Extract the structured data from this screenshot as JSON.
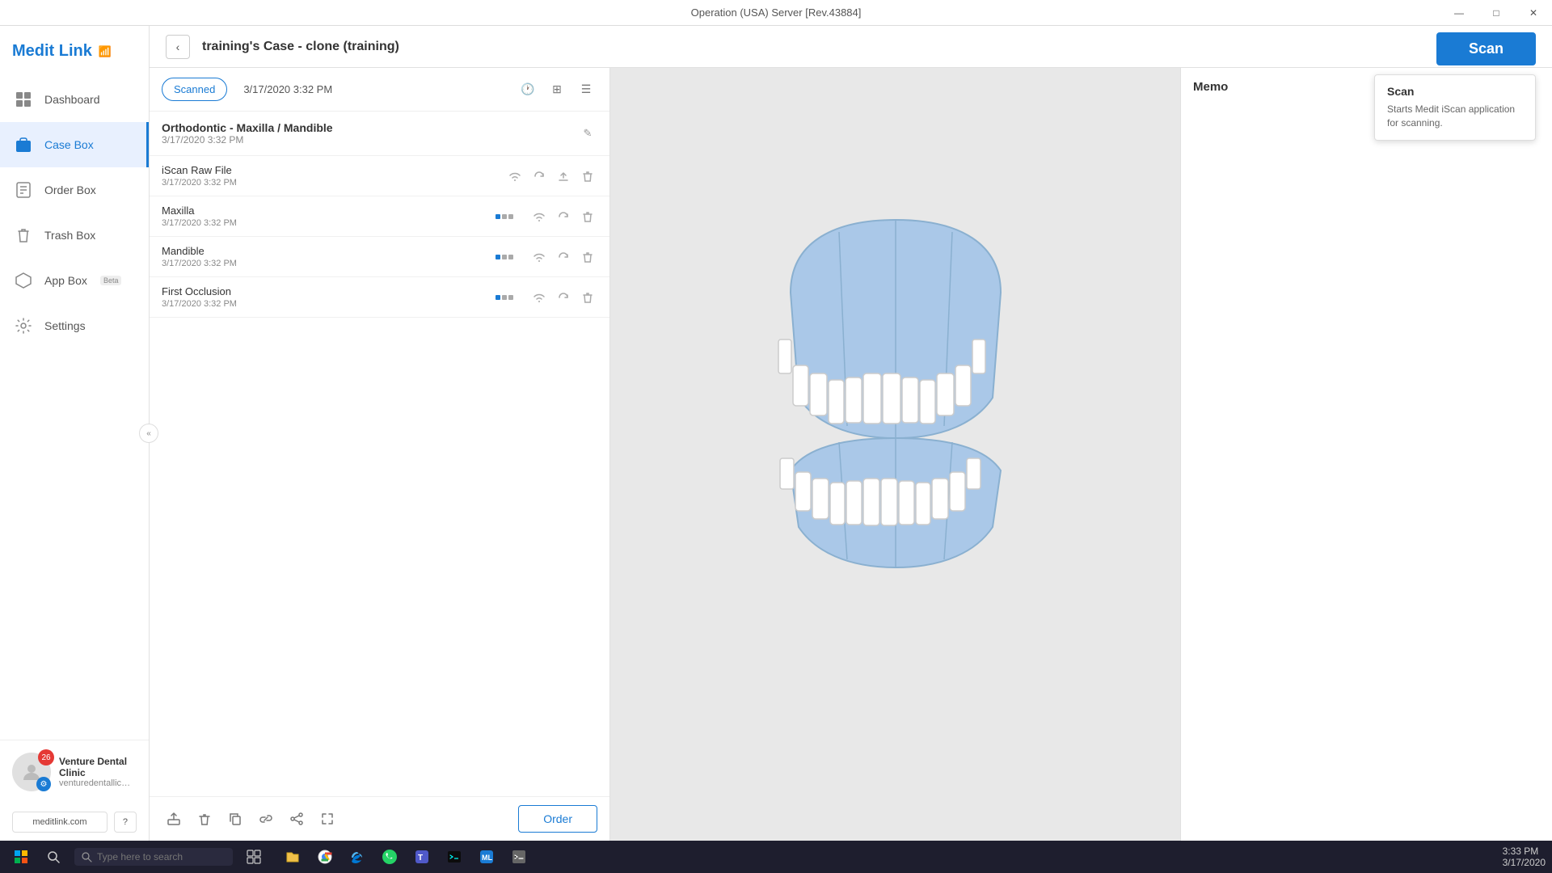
{
  "app": {
    "title": "Operation (USA) Server [Rev.43884]",
    "logo": "Medit Link",
    "wifi_icon": "📶"
  },
  "titlebar": {
    "minimize": "—",
    "maximize": "□",
    "close": "✕"
  },
  "sidebar": {
    "collapse_icon": "«",
    "items": [
      {
        "id": "dashboard",
        "label": "Dashboard",
        "icon": "⊞",
        "active": false
      },
      {
        "id": "case-box",
        "label": "Case Box",
        "icon": "📁",
        "active": true
      },
      {
        "id": "order-box",
        "label": "Order Box",
        "icon": "📋",
        "active": false
      },
      {
        "id": "trash-box",
        "label": "Trash Box",
        "icon": "🗑",
        "active": false
      },
      {
        "id": "app-box",
        "label": "App Box",
        "badge": "Beta",
        "icon": "⬡",
        "active": false
      },
      {
        "id": "settings",
        "label": "Settings",
        "icon": "⚙",
        "active": false
      }
    ],
    "user": {
      "name": "Venture Dental Clinic",
      "email": "venturedentallic@gmail.c...",
      "notification_count": "26"
    },
    "footer": {
      "website_label": "meditlink.com",
      "help_icon": "?"
    }
  },
  "topbar": {
    "back_icon": "‹",
    "case_title": "training's Case - clone (training)",
    "edit_icon": "✎",
    "scan_label": "Scan"
  },
  "scan_tooltip": {
    "title": "Scan",
    "description": "Starts Medit iScan application for scanning."
  },
  "file_panel": {
    "tab_label": "Scanned",
    "date": "3/17/2020 3:32 PM",
    "view_icons": [
      "🕐",
      "⊞",
      "☰"
    ],
    "items": [
      {
        "name": "Orthodontic - Maxilla / Mandible",
        "date": "3/17/2020 3:32 PM",
        "type": "group",
        "actions": [
          "edit"
        ]
      },
      {
        "name": "iScan Raw File",
        "date": "3/17/2020 3:32 PM",
        "type": "file",
        "actions": [
          "wifi",
          "sync",
          "upload",
          "delete"
        ]
      },
      {
        "name": "Maxilla",
        "date": "3/17/2020 3:32 PM",
        "type": "file",
        "actions": [
          "device",
          "wifi",
          "sync",
          "delete"
        ]
      },
      {
        "name": "Mandible",
        "date": "3/17/2020 3:32 PM",
        "type": "file",
        "actions": [
          "device",
          "wifi",
          "sync",
          "delete"
        ]
      },
      {
        "name": "First Occlusion",
        "date": "3/17/2020 3:32 PM",
        "type": "file",
        "actions": [
          "device",
          "wifi",
          "sync",
          "delete"
        ]
      }
    ],
    "bottom_icons": [
      "export",
      "delete",
      "copy",
      "link",
      "share",
      "fullscreen"
    ],
    "order_button": "Order"
  },
  "memo": {
    "title": "Memo"
  },
  "taskbar": {
    "time": "3:33 PM",
    "date": "3/17/2020",
    "search_placeholder": "Type here to search"
  }
}
